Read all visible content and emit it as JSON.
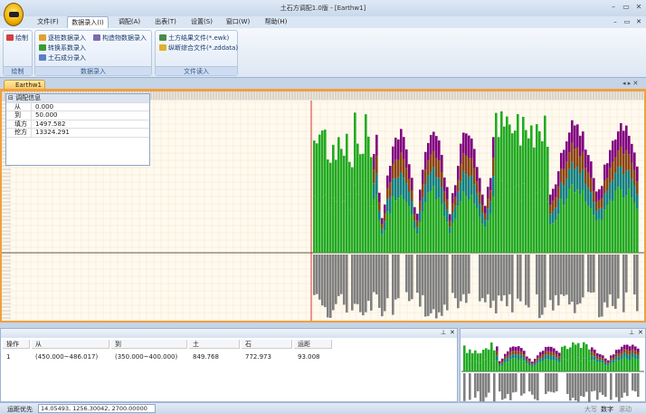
{
  "window": {
    "title": "土石方调配1.0版 - [Earthw1]",
    "min": "–",
    "max": "▭",
    "close": "✕",
    "mdi_min": "–",
    "mdi_restore": "▭",
    "mdi_close": "✕"
  },
  "menu": [
    "文件(F)",
    "数据录入(I)",
    "调配(A)",
    "出表(T)",
    "设置(S)",
    "窗口(W)",
    "帮助(H)"
  ],
  "ribbon": {
    "group_draw": {
      "label": "绘制",
      "button": "绘制"
    },
    "group_input": {
      "label": "数据录入",
      "buttons": [
        "逐桩数据录入",
        "转换系数录入",
        "土石成分录入",
        "构造物数据录入"
      ]
    },
    "group_read": {
      "label": "文件读入",
      "buttons": [
        "土方结果文件(*.ewk)",
        "纵断综合文件(*.zddata)"
      ]
    }
  },
  "doc_tab": "Earthw1",
  "info_panel": {
    "title": "调配信息",
    "rows": [
      {
        "label": "从",
        "value": "0.000"
      },
      {
        "label": "到",
        "value": "50.000"
      },
      {
        "label": "填方",
        "value": "1497.582"
      },
      {
        "label": "挖方",
        "value": "13324.291"
      }
    ]
  },
  "table": {
    "columns": [
      "操作",
      "从",
      "到",
      "土",
      "石",
      "运距"
    ],
    "rows": [
      [
        "1",
        "(450.000~486.017)",
        "(350.000~400.000)",
        "849.768",
        "772.973",
        "93.008"
      ]
    ]
  },
  "status": {
    "mode": "运距优先",
    "coords": "14.05493, 1256.30042, 2700.00000",
    "caps": "大写",
    "num": "数字",
    "scroll": "滚动"
  },
  "colors": {
    "fill": "#22aa22",
    "cut": "#808080",
    "purple": "#800080",
    "brown": "#8b4513",
    "teal": "#138080",
    "red": "#cc0000"
  }
}
